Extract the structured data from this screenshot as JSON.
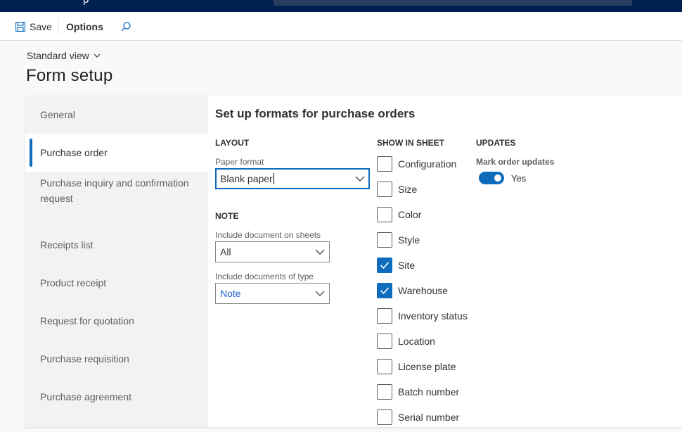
{
  "topbar": {
    "title_fragment": "p"
  },
  "actionbar": {
    "save_label": "Save",
    "options_label": "Options"
  },
  "view": {
    "label": "Standard view"
  },
  "page": {
    "title": "Form setup"
  },
  "tabs": [
    {
      "label": "General"
    },
    {
      "label": "Purchase order"
    },
    {
      "label": "Purchase inquiry and confirmation request"
    },
    {
      "label": "Receipts list"
    },
    {
      "label": "Product receipt"
    },
    {
      "label": "Request for quotation"
    },
    {
      "label": "Purchase requisition"
    },
    {
      "label": "Purchase agreement"
    }
  ],
  "content": {
    "section_title": "Set up formats for purchase orders",
    "layout": {
      "header": "LAYOUT",
      "paper_format_label": "Paper format",
      "paper_format_value": "Blank paper"
    },
    "note": {
      "header": "NOTE",
      "include_doc_label": "Include document on sheets",
      "include_doc_value": "All",
      "include_type_label": "Include documents of type",
      "include_type_value": "Note"
    },
    "show_in_sheet": {
      "header": "SHOW IN SHEET",
      "items": [
        {
          "label": "Configuration",
          "checked": false
        },
        {
          "label": "Size",
          "checked": false
        },
        {
          "label": "Color",
          "checked": false
        },
        {
          "label": "Style",
          "checked": false
        },
        {
          "label": "Site",
          "checked": true
        },
        {
          "label": "Warehouse",
          "checked": true
        },
        {
          "label": "Inventory status",
          "checked": false
        },
        {
          "label": "Location",
          "checked": false
        },
        {
          "label": "License plate",
          "checked": false
        },
        {
          "label": "Batch number",
          "checked": false
        },
        {
          "label": "Serial number",
          "checked": false
        }
      ]
    },
    "updates": {
      "header": "UPDATES",
      "mark_label": "Mark order updates",
      "toggle_value": "Yes",
      "toggle_on": true
    }
  },
  "colors": {
    "accent": "#0f6cbd",
    "topbar": "#002050"
  }
}
